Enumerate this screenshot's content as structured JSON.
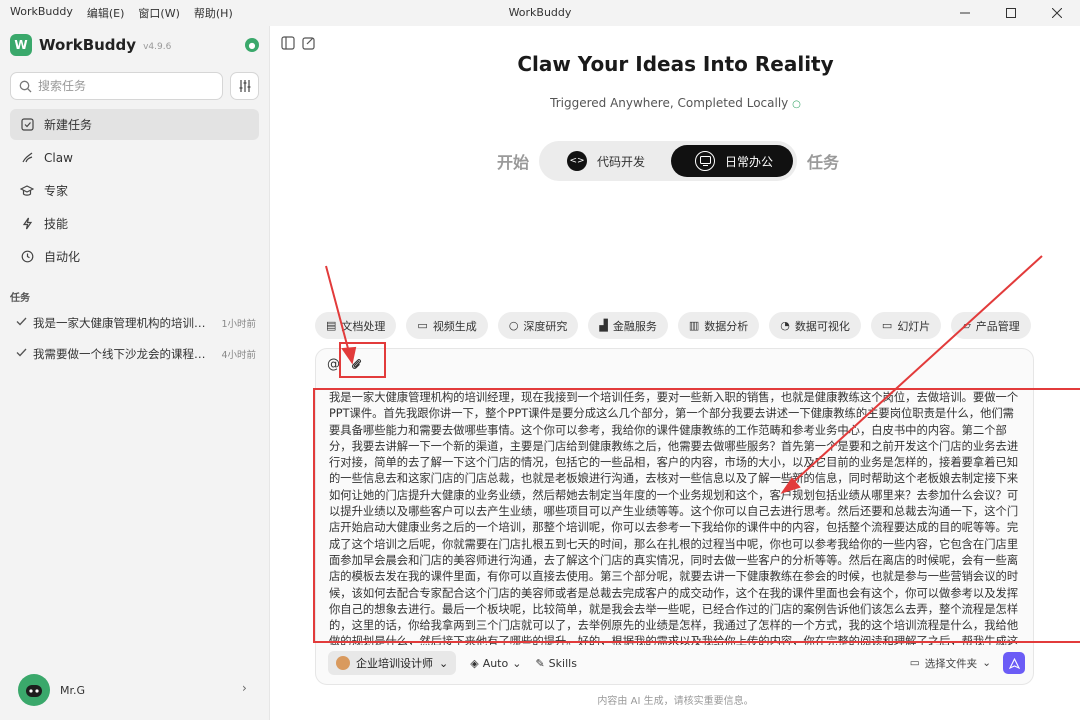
{
  "menu": {
    "app": "WorkBuddy",
    "edit": "编辑(E)",
    "window": "窗口(W)",
    "help": "帮助(H)"
  },
  "window": {
    "title": "WorkBuddy"
  },
  "brand": {
    "name": "WorkBuddy",
    "version": "v4.9.6"
  },
  "search": {
    "placeholder": "搜索任务"
  },
  "nav": [
    {
      "label": "新建任务",
      "icon": "new-task-icon"
    },
    {
      "label": "Claw",
      "icon": "claw-icon"
    },
    {
      "label": "专家",
      "icon": "expert-icon"
    },
    {
      "label": "技能",
      "icon": "skills-icon"
    },
    {
      "label": "自动化",
      "icon": "clock-icon"
    }
  ],
  "tasks_section": {
    "label": "任务"
  },
  "tasks": [
    {
      "title": "我是一家大健康管理机构的培训经理…",
      "time": "1小时前"
    },
    {
      "title": "我需要做一个线下沙龙会的课程规划…",
      "time": "4小时前"
    }
  ],
  "user": {
    "name": "Mr.G"
  },
  "hero": {
    "title": "Claw Your Ideas Into Reality",
    "subtitle": "Triggered Anywhere, Completed Locally"
  },
  "mode": {
    "prefix": "开始",
    "suffix": "任务",
    "options": [
      {
        "label": "代码开发",
        "icon": "code-icon",
        "active": false
      },
      {
        "label": "日常办公",
        "icon": "monitor-icon",
        "active": true
      }
    ]
  },
  "chips": [
    {
      "label": "文档处理",
      "icon": "document-icon"
    },
    {
      "label": "视频生成",
      "icon": "video-icon"
    },
    {
      "label": "深度研究",
      "icon": "search-icon"
    },
    {
      "label": "金融服务",
      "icon": "finance-icon"
    },
    {
      "label": "数据分析",
      "icon": "bar-chart-icon"
    },
    {
      "label": "数据可视化",
      "icon": "pie-chart-icon"
    },
    {
      "label": "幻灯片",
      "icon": "slides-icon"
    },
    {
      "label": "产品管理",
      "icon": "folder-icon"
    }
  ],
  "composer": {
    "text": "我是一家大健康管理机构的培训经理，现在我接到一个培训任务，要对一些新入职的销售，也就是健康教练这个岗位，去做培训。要做一个PPT课件。首先我跟你讲一下，整个PPT课件是要分成这么几个部分，第一个部分我要去讲述一下健康教练的主要岗位职责是什么，他们需要具备哪些能力和需要去做哪些事情。这个你可以参考，我给你的课件健康教练的工作范畴和参考业务中心，白皮书中的内容。第二个部分，我要去讲解一下一个新的渠道，主要是门店给到健康教练之后，他需要去做哪些服务？首先第一个是要和之前开发这个门店的业务去进行对接，简单的去了解一下这个门店的情况，包括它的一些品相，客户的内容，市场的大小，以及它目前的业务是怎样的，接着要拿着已知的一些信息去和这家门店的门店总裁，也就是老板娘进行沟通，去核对一些信息以及了解一些新的信息，同时帮助这个老板娘去制定接下来如何让她的门店提升大健康的业务业绩，然后帮她去制定当年度的一个业务规划和这个，客户规划包括业绩从哪里来？去参加什么会议？可以提升业绩以及哪些客户可以去产生业绩，哪些项目可以产生业绩等等。这个你可以自己去进行思考。然后还要和总裁去沟通一下，这个门店开始启动大健康业务之后的一个培训，那整个培训呢，你可以去参考一下我给你的课件中的内容，包括整个流程要达成的目的呢等等。完成了这个培训之后呢，你就需要在门店扎根五到七天的时间，那么在扎根的过程当中呢，你也可以参考我给你的一些内容，它包含在门店里面参加早会晨会和门店的美容师进行沟通，去了解这个门店的真实情况，同时去做一些客户的分析等等。然后在离店的时候呢，会有一些离店的模板去发在我的课件里面，有你可以直接去使用。第三个部分呢，就要去讲一下健康教练在参会的时候，也就是参与一些营销会议的时候，该如何去配合专家配合这个门店的美容师或者是总裁去完成客户的成交动作，这个在我的课件里面也会有这个，你可以做参考以及发挥你自己的想象去进行。最后一个板块呢，比较简单，就是我会去举一些呢，已经合作过的门店的案例告诉他们该怎么去弄，整个流程是怎样的，这里的话，你给我拿两到三个门店就可以了，去举例原先的业绩是怎样，我通过了怎样的一个方式，我的这个培训流程是什么，我给他做的规划是什么，然后接下来他有了哪些的提升。好的，根据我的需求以及我给你上传的内容，你在完整的阅读和理解了之后，帮我生成这样的一个培训课件"
  },
  "composer_bar": {
    "role": "企业培训设计师",
    "model": "Auto",
    "skills": "Skills",
    "folder": "选择文件夹"
  },
  "footer": {
    "note": "内容由 AI 生成，请核实重要信息。"
  },
  "colors": {
    "accent": "#3aa86b",
    "send": "#6b5cf6",
    "annotation": "#e23b3b"
  }
}
